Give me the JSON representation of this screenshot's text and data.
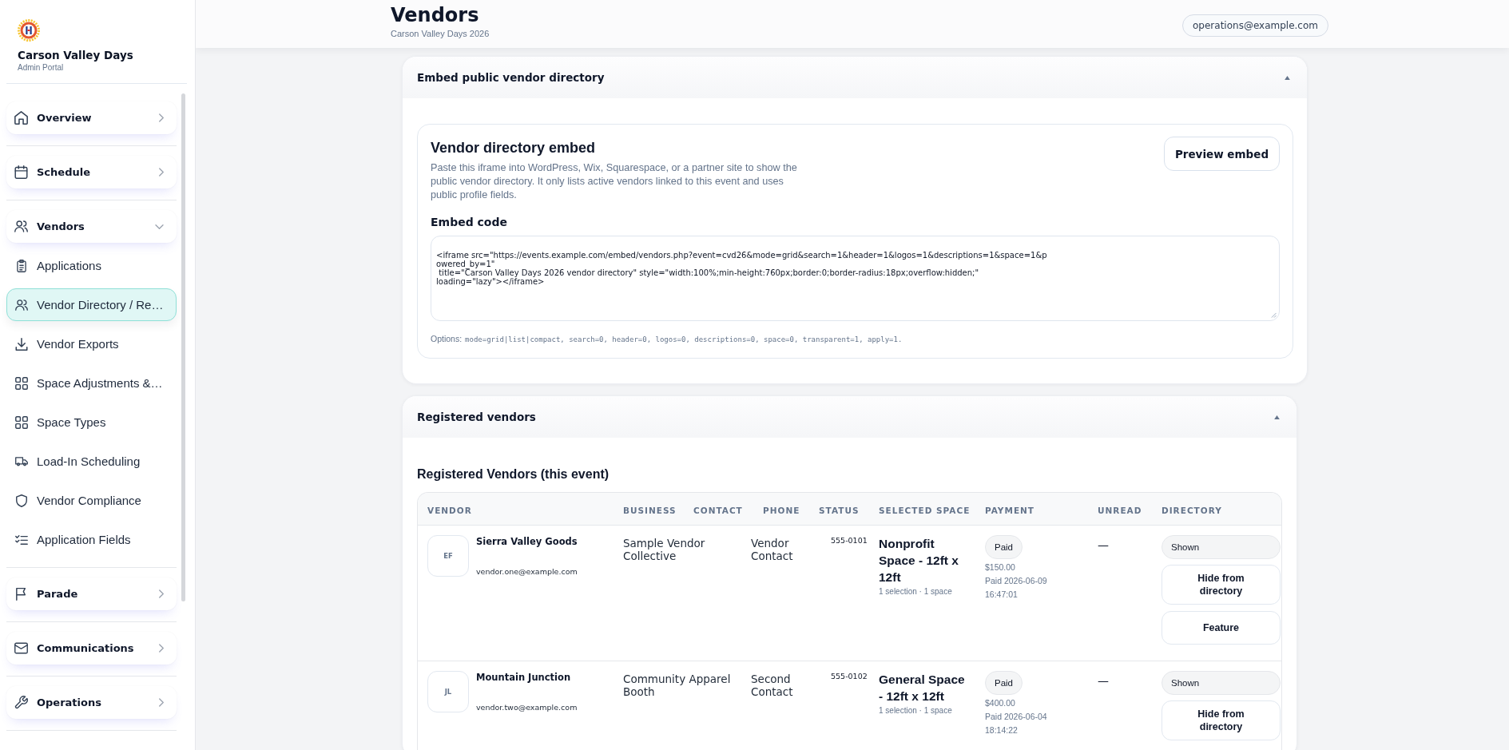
{
  "sidebar": {
    "brand": {
      "title": "Carson Valley Days",
      "subtitle": "Admin Portal"
    },
    "nav": [
      {
        "label": "Overview",
        "expanded": false
      },
      {
        "label": "Schedule",
        "expanded": false
      },
      {
        "label": "Vendors",
        "expanded": true,
        "children": [
          {
            "label": "Applications",
            "selected": false
          },
          {
            "label": "Vendor Directory / Re…",
            "selected": true
          },
          {
            "label": "Vendor Exports",
            "selected": false
          },
          {
            "label": "Space Adjustments &…",
            "selected": false
          },
          {
            "label": "Space Types",
            "selected": false
          },
          {
            "label": "Load-In Scheduling",
            "selected": false
          },
          {
            "label": "Vendor Compliance",
            "selected": false
          },
          {
            "label": "Application Fields",
            "selected": false
          }
        ]
      },
      {
        "label": "Parade",
        "expanded": false
      },
      {
        "label": "Communications",
        "expanded": false
      },
      {
        "label": "Operations",
        "expanded": false
      }
    ]
  },
  "header": {
    "title": "Vendors",
    "subtitle": "Carson Valley Days 2026",
    "account": "operations@example.com"
  },
  "panels": [
    {
      "kind": "embed",
      "title": "Embed public vendor directory",
      "expanded": true,
      "heading": "Vendor directory embed",
      "description": "Paste this iframe into WordPress, Wix, Squarespace, or a partner site to show the public vendor directory. It only lists active vendors linked to this event and uses public profile fields.",
      "button": "Preview embed",
      "code_label": "Embed code",
      "code": "<iframe src=\"https://events.example.com/embed/vendors.php?event=cvd26&mode=grid&search=1&header=1&logos=1&descriptions=1&space=1&p\nowered_by=1\"\n title=\"Carson Valley Days 2026 vendor directory\" style=\"width:100%;min-height:760px;border:0;border-radius:18px;overflow:hidden;\"\nloading=\"lazy\"></iframe>",
      "options_label": "Options:",
      "options": "mode=grid|list|compact, search=0, header=0, logos=0, descriptions=0, space=0, transparent=1, apply=1."
    },
    {
      "kind": "table",
      "title": "Registered vendors",
      "expanded": true,
      "heading": "Registered Vendors (this event)",
      "table": {
        "columns": [
          "VENDOR",
          "BUSINESS",
          "CONTACT",
          "PHONE",
          "STATUS",
          "SELECTED SPACE",
          "PAYMENT",
          "UNREAD",
          "DIRECTORY"
        ],
        "rows": [
          {
            "initials": "EF",
            "name": "Sierra Valley Goods",
            "email": "vendor.one@example.com",
            "business": "Sample Vendor Collective",
            "contact": "Vendor Contact",
            "phone": "555-0101",
            "space": "Nonprofit Space - 12ft x 12ft",
            "space_summary": "1 selection · 1 space",
            "payment_status": "Paid",
            "amount": "$150.00",
            "paid_at": "Paid 2026-06-09 16:47:01",
            "unread": "—",
            "directory_status": "Shown",
            "actions": [
              "Hide from directory",
              "Feature"
            ]
          },
          {
            "initials": "JL",
            "name": "Mountain Junction",
            "email": "vendor.two@example.com",
            "business": "Community Apparel Booth",
            "contact": "Second Contact",
            "phone": "555-0102",
            "space": "General Space - 12ft x 12ft",
            "space_summary": "1 selection · 1 space",
            "payment_status": "Paid",
            "amount": "$400.00",
            "paid_at": "Paid 2026-06-04 18:14:22",
            "unread": "—",
            "directory_status": "Shown",
            "actions": [
              "Hide from directory"
            ]
          }
        ]
      }
    }
  ]
}
